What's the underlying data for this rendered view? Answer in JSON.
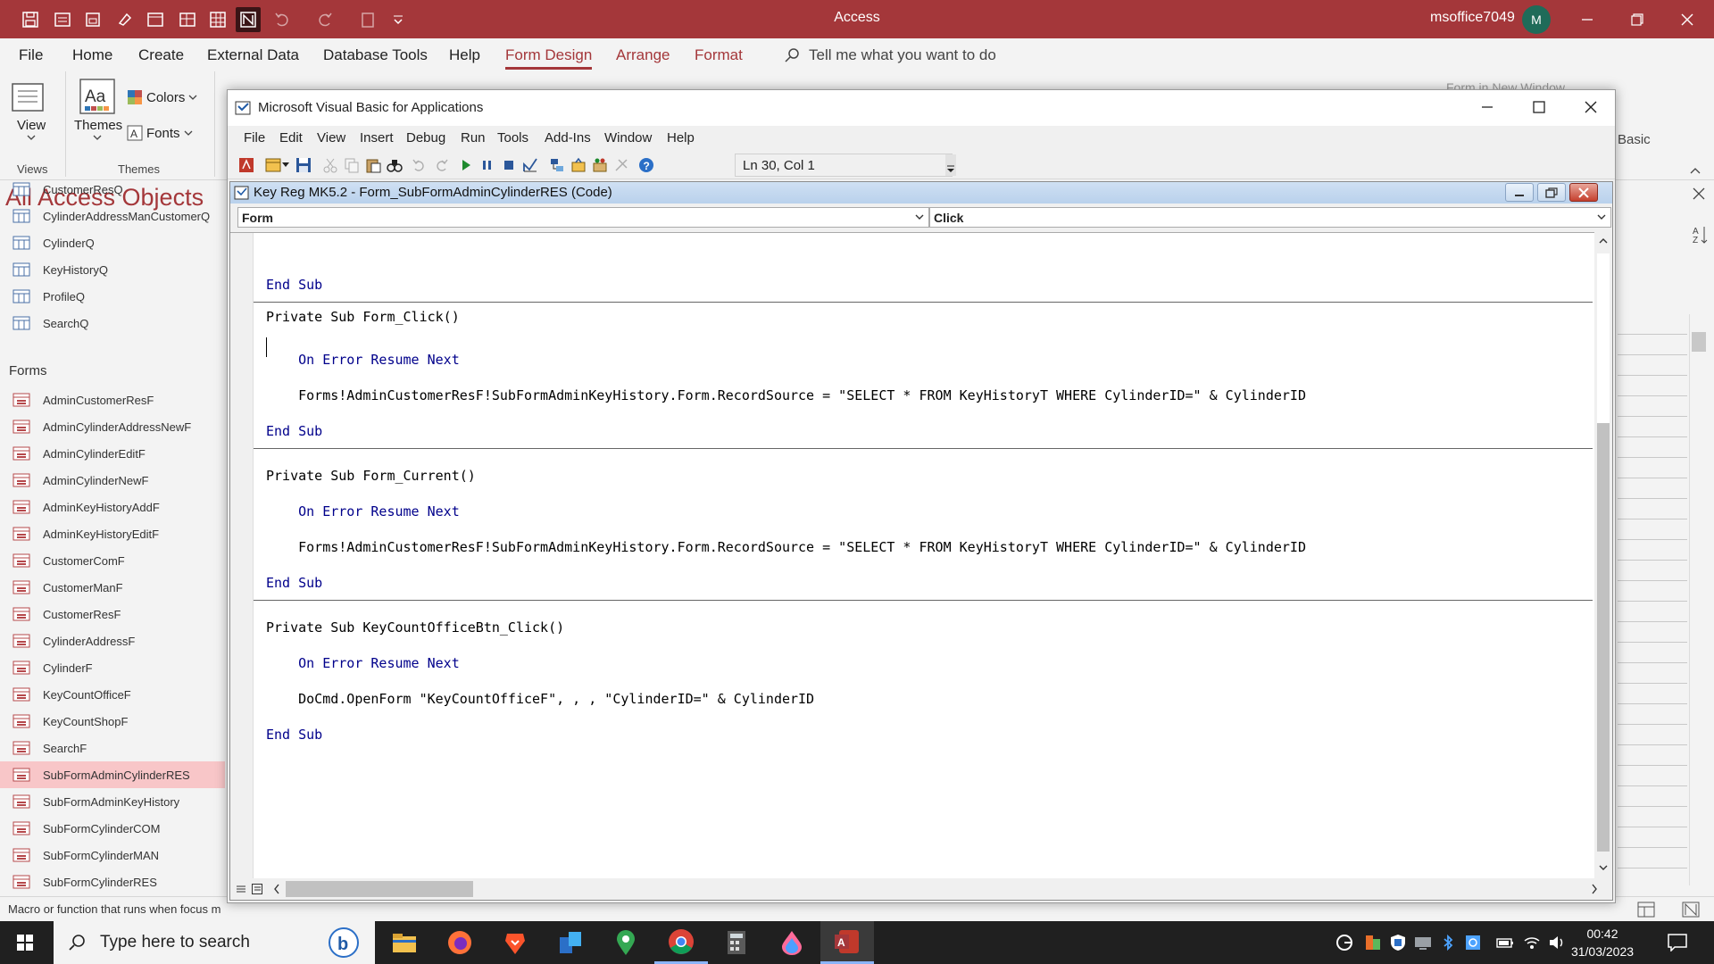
{
  "access": {
    "title": "Access",
    "user": "msoffice7049",
    "avatar_initial": "M",
    "accent": "#a4373a"
  },
  "ribbon": {
    "tabs": [
      "File",
      "Home",
      "Create",
      "External Data",
      "Database Tools",
      "Help",
      "Form Design",
      "Arrange",
      "Format"
    ],
    "active_tab": "Form Design",
    "tell_me": "Tell me what you want to do",
    "view_label": "View",
    "themes_label": "Themes",
    "colors_label": "Colors",
    "fonts_label": "Fonts",
    "group_views": "Views",
    "group_themes": "Themes",
    "behind_text_1": "Form in New Window",
    "behind_text_2": "Basic"
  },
  "nav": {
    "title": "All Access Objects",
    "queries": [
      "CustomerResQ",
      "CylinderAddressManCustomerQ",
      "CylinderQ",
      "KeyHistoryQ",
      "ProfileQ",
      "SearchQ"
    ],
    "forms_header": "Forms",
    "forms": [
      "AdminCustomerResF",
      "AdminCylinderAddressNewF",
      "AdminCylinderEditF",
      "AdminCylinderNewF",
      "AdminKeyHistoryAddF",
      "AdminKeyHistoryEditF",
      "CustomerComF",
      "CustomerManF",
      "CustomerResF",
      "CylinderAddressF",
      "CylinderF",
      "KeyCountOfficeF",
      "KeyCountShopF",
      "SearchF",
      "SubFormAdminCylinderRES",
      "SubFormAdminKeyHistory",
      "SubFormCylinderCOM",
      "SubFormCylinderMAN",
      "SubFormCylinderRES"
    ],
    "selected": "SubFormAdminCylinderRES"
  },
  "status_bar": "Macro or function that runs when focus m",
  "vba": {
    "title": "Microsoft Visual Basic for Applications",
    "menus": [
      "File",
      "Edit",
      "View",
      "Insert",
      "Debug",
      "Run",
      "Tools",
      "Add-Ins",
      "Window",
      "Help"
    ],
    "position": "Ln 30, Col 1",
    "code_window_title": "Key Reg MK5.2 - Form_SubFormAdminCylinderRES (Code)",
    "object_combo": "Form",
    "procedure_combo": "Click",
    "code": {
      "l1": "End Sub",
      "l2": "Private Sub Form_Click()",
      "l3": "    On Error Resume Next",
      "l4": "    Forms!AdminCustomerResF!SubFormAdminKeyHistory.Form.RecordSource = \"SELECT * FROM KeyHistoryT WHERE CylinderID=\" & CylinderID",
      "l5": "End Sub",
      "l6": "Private Sub Form_Current()",
      "l7": "    On Error Resume Next",
      "l8": "    Forms!AdminCustomerResF!SubFormAdminKeyHistory.Form.RecordSource = \"SELECT * FROM KeyHistoryT WHERE CylinderID=\" & CylinderID",
      "l9": "End Sub",
      "l10": "Private Sub KeyCountOfficeBtn_Click()",
      "l11": "    On Error Resume Next",
      "l12": "    DoCmd.OpenForm \"KeyCountOfficeF\", , , \"CylinderID=\" & CylinderID",
      "l13": "End Sub"
    }
  },
  "taskbar": {
    "search_placeholder": "Type here to search",
    "time": "00:42",
    "date": "31/03/2023"
  }
}
